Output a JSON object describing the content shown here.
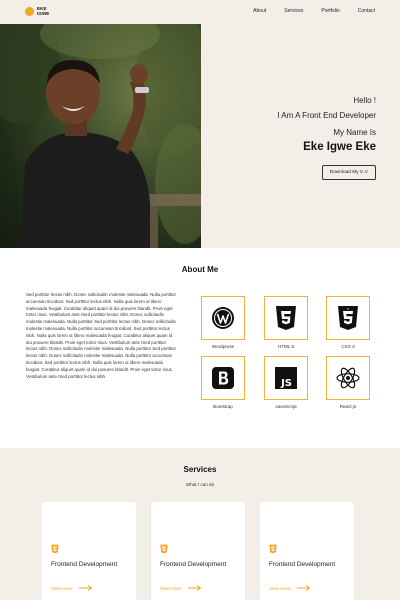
{
  "brand": {
    "line1": "EKE",
    "line2": "IGWE",
    "accent": "#f3a623"
  },
  "nav": {
    "items": [
      "About",
      "Services",
      "Portfolio",
      "Contact"
    ]
  },
  "hero": {
    "hello": "Hello !",
    "role": "I Am A Front End Developer",
    "my_name": "My Name Is",
    "name": "Eke Igwe Eke",
    "cv_button": "Download My C.V"
  },
  "about": {
    "title": "About Me",
    "text": "Sed porttitor lectus nibh. Donec sollicitudin molestie malesuada. Nulla porttitor accumsan tincidunt. Sed porttitor lectus nibh. Nulla quis lorem ut libero malesuada feugiat. Curabitur aliquet quam id dui posuere blandit. Proin eget tortor risus. Vestibulum ante ISed porttitor lectus nibh. Donec sollicitudin molestie malesuada. Nulla porttitor Sed porttitor lectus nibh. Donec sollicitudin molestie malesuada. Nulla porttitor accumsan tincidunt. Sed porttitor lectus nibh. Nulla quis lorem ut libero malesuada feugiat. Curabitur aliquet quam id dui posuere blandit. Proin eget tortor risus. Vestibulum ante ISed porttitor lectus nibh. Donec sollicitudin molestie malesuada. Nulla porttitor Sed porttitor lectus nibh. Donec sollicitudin molestie malesuada. Nulla porttitor accumsan tincidunt. Sed porttitor lectus nibh. Nulla quis lorem ut libero malesuada feugiat. Curabitur aliquet quam id dui posuere blandit. Proin eget tortor risus. Vestibulum ante ISed porttitor lectus nibh.",
    "skills": [
      "Wordpress",
      "HTML 5",
      "CSS 3",
      "Bootstrap",
      "JavaScript",
      "React.js"
    ]
  },
  "services": {
    "title": "Services",
    "subtitle": "What I can do",
    "cards": [
      {
        "title": "Frontend Development",
        "link": "View more"
      },
      {
        "title": "Frontend Development",
        "link": "View more"
      },
      {
        "title": "Frontend Development",
        "link": "View more"
      }
    ]
  }
}
